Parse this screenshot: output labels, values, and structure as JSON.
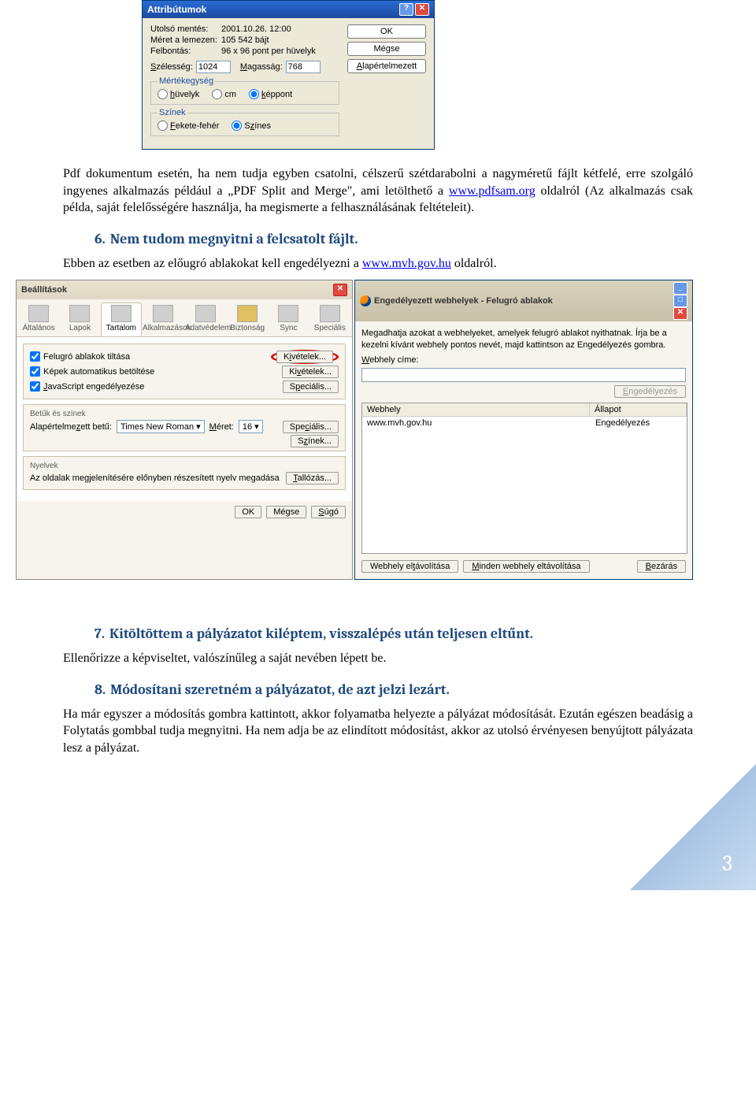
{
  "attr_dialog": {
    "title": "Attribútumok",
    "rows": {
      "last_save_label": "Utolsó mentés:",
      "last_save_value": "2001.10.26. 12:00",
      "size_label": "Méret a lemezen:",
      "size_value": "105 542 bájt",
      "res_label": "Felbontás:",
      "res_value": "96 x 96 pont per hüvelyk",
      "width_label": "Szélesség:",
      "width_value": "1024",
      "height_label": "Magasság:",
      "height_value": "768"
    },
    "unit_group": {
      "legend": "Mértékegység",
      "inch": "hüvelyk",
      "cm": "cm",
      "pixel": "képpont"
    },
    "color_group": {
      "legend": "Színek",
      "bw": "Fekete-fehér",
      "color": "Színes"
    },
    "buttons": {
      "ok": "OK",
      "cancel": "Mégse",
      "default": "Alapértelmezett"
    }
  },
  "para1": "Pdf dokumentum esetén, ha nem tudja egyben csatolni, célszerű szétdarabolni a nagyméretű fájlt kétfelé, erre szolgáló ingyenes alkalmazás például a „PDF Split and Merge\", ami letölthető a ",
  "para1_link": "www.pdfsam.org",
  "para1_b": " oldalról (Az alkalmazás csak példa, saját felelősségére használja, ha megismerte a felhasználásának feltételeit).",
  "h6_num": "6.",
  "h6": "Nem tudom megnyitni a felcsatolt fájlt.",
  "para_h6": "Ebben az esetben az előugró ablakokat kell engedélyezni a ",
  "para_h6_link": "www.mvh.gov.hu",
  "para_h6_b": " oldalról.",
  "settings": {
    "title": "Beállítások",
    "tabs": {
      "general": "Általános",
      "tabs": "Lapok",
      "content": "Tartalom",
      "apps": "Alkalmazások",
      "privacy": "Adatvédelem",
      "security": "Biztonság",
      "sync": "Sync",
      "special": "Speciális"
    },
    "chk_popup": "Felugró ablakok tiltása",
    "chk_images": "Képek automatikus betöltése",
    "chk_js": "JavaScript engedélyezése",
    "btn_exceptions": "Kivételek...",
    "btn_special": "Speciális...",
    "sec_fonts": "Betűk és színek",
    "font_label": "Alapértelmezett betű:",
    "font_value": "Times New Roman",
    "size_label": "Méret:",
    "size_value": "16",
    "btn_colors": "Színek...",
    "sec_lang": "Nyelvek",
    "lang_desc": "Az oldalak megjelenítésére előnyben részesített nyelv megadása",
    "btn_browse": "Tallózás...",
    "btn_ok": "OK",
    "btn_cancel": "Mégse",
    "btn_help": "Súgó"
  },
  "popup": {
    "title": "Engedélyezett webhelyek - Felugró ablakok",
    "desc": "Megadhatja azokat a webhelyeket, amelyek felugró ablakot nyithatnak. Írja be a kezelni kívánt webhely pontos nevét, majd kattintson az Engedélyezés gombra.",
    "addr_label": "Webhely címe:",
    "btn_allow": "Engedélyezés",
    "th_site": "Webhely",
    "th_status": "Állapot",
    "row_site": "www.mvh.gov.hu",
    "row_status": "Engedélyezés",
    "btn_remove": "Webhely eltávolítása",
    "btn_remove_all": "Minden webhely eltávolítása",
    "btn_close": "Bezárás"
  },
  "h7_num": "7.",
  "h7": "Kitöltöttem a pályázatot kiléptem, visszalépés után teljesen eltűnt.",
  "para_h7": "Ellenőrizze a képviseltet, valószínűleg a saját nevében lépett be.",
  "h8_num": "8.",
  "h8": "Módosítani szeretném a pályázatot, de azt jelzi lezárt.",
  "para_h8": "Ha már egyszer a módosítás gombra kattintott, akkor folyamatba helyezte a pályázat módosítását. Ezután egészen beadásig a Folytatás gombbal tudja megnyitni. Ha nem adja be az elindított módosítást, akkor az utolsó érvényesen benyújtott pályázata lesz a pályázat.",
  "page_number": "3"
}
